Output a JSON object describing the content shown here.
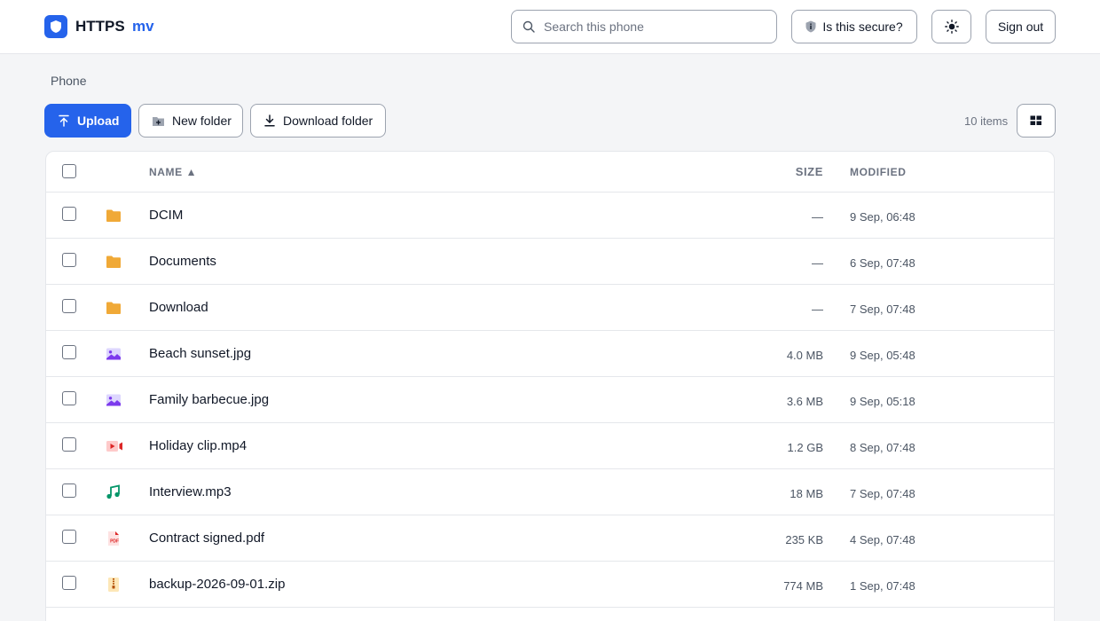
{
  "app": {
    "name": "HTTPS",
    "subname": "mv",
    "brand_color": "#2563eb"
  },
  "header": {
    "search_placeholder": "Search this phone",
    "secure_label": "Is this secure?",
    "signout_label": "Sign out",
    "theme_icon": "sun-icon"
  },
  "breadcrumb": "Phone",
  "toolbar": {
    "upload_label": "Upload",
    "new_folder_label": "New folder",
    "download_folder_label": "Download folder",
    "item_count": "10 items",
    "view_icon": "grid-view-icon"
  },
  "table": {
    "columns": {
      "name": "NAME ▲",
      "size": "SIZE",
      "modified": "MODIFIED"
    },
    "rows": [
      {
        "name": "DCIM",
        "size": "—",
        "modified": "9 Sep, 06:48",
        "icon": "folder-icon"
      },
      {
        "name": "Documents",
        "size": "—",
        "modified": "6 Sep, 07:48",
        "icon": "folder-icon"
      },
      {
        "name": "Download",
        "size": "—",
        "modified": "7 Sep, 07:48",
        "icon": "folder-icon"
      },
      {
        "name": "Beach sunset.jpg",
        "size": "4.0 MB",
        "modified": "9 Sep, 05:48",
        "icon": "image-file-icon"
      },
      {
        "name": "Family barbecue.jpg",
        "size": "3.6 MB",
        "modified": "9 Sep, 05:18",
        "icon": "image-file-icon"
      },
      {
        "name": "Holiday clip.mp4",
        "size": "1.2 GB",
        "modified": "8 Sep, 07:48",
        "icon": "video-file-icon"
      },
      {
        "name": "Interview.mp3",
        "size": "18 MB",
        "modified": "7 Sep, 07:48",
        "icon": "audio-file-icon"
      },
      {
        "name": "Contract signed.pdf",
        "size": "235 KB",
        "modified": "4 Sep, 07:48",
        "icon": "pdf-file-icon"
      },
      {
        "name": "backup-2026-09-01.zip",
        "size": "774 MB",
        "modified": "1 Sep, 07:48",
        "icon": "zip-file-icon"
      }
    ]
  }
}
